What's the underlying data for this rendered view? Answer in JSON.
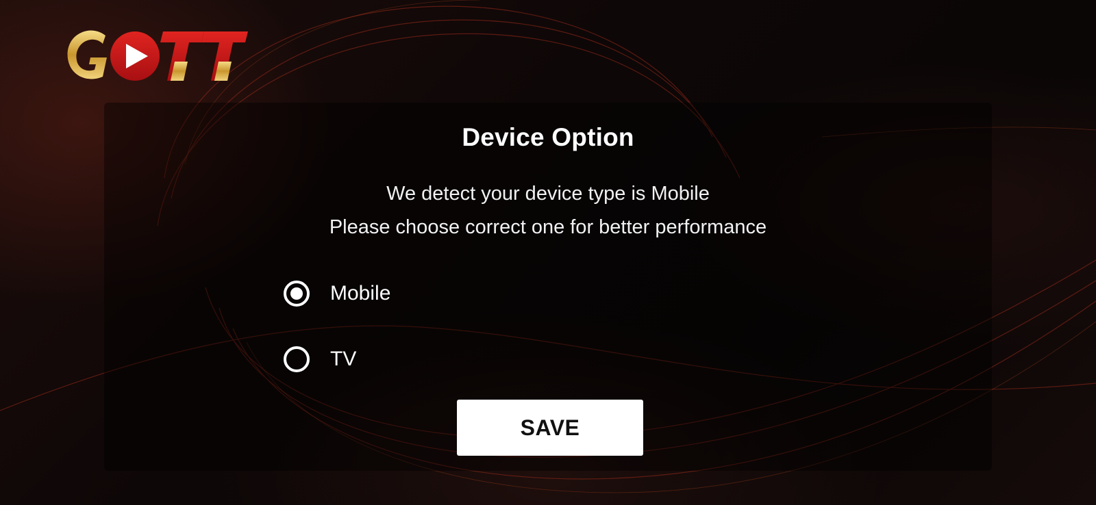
{
  "app": {
    "logo_text": "GOTT",
    "logo_icon": "play-icon",
    "colors": {
      "logo_gold": "#d9b24a",
      "logo_red": "#d2171b",
      "accent": "#ffffff"
    }
  },
  "dialog": {
    "title": "Device Option",
    "message_line1": "We detect your device type is Mobile",
    "message_line2": "Please choose correct one for better performance",
    "options": [
      {
        "label": "Mobile",
        "selected": true
      },
      {
        "label": "TV",
        "selected": false
      }
    ],
    "save_label": "SAVE"
  }
}
